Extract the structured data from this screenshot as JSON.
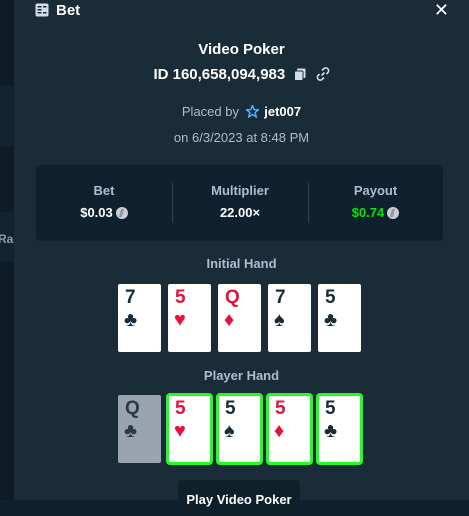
{
  "background": {
    "peek_text": "Rac"
  },
  "modal": {
    "title": "Bet",
    "close_symbol": "✕",
    "icons": {
      "header": "receipt-icon",
      "copy": "copy-icon",
      "link": "link-icon",
      "vip": "vip-star-icon",
      "coin": "litecoin-icon"
    }
  },
  "bet": {
    "game": "Video Poker",
    "id": "ID 160,658,094,983",
    "placed_by_label": "Placed by",
    "user": "jet007",
    "date": "on 6/3/2023 at 8:48 PM"
  },
  "stats": {
    "bet_label": "Bet",
    "bet_value": "$0.03",
    "multiplier_label": "Multiplier",
    "multiplier_value": "22.00×",
    "payout_label": "Payout",
    "payout_value": "$0.74"
  },
  "initial_hand": {
    "label": "Initial Hand",
    "cards": [
      {
        "rank": "7",
        "suit": "♣",
        "color": "black"
      },
      {
        "rank": "5",
        "suit": "♥",
        "color": "red"
      },
      {
        "rank": "Q",
        "suit": "♦",
        "color": "red"
      },
      {
        "rank": "7",
        "suit": "♠",
        "color": "black"
      },
      {
        "rank": "5",
        "suit": "♣",
        "color": "black"
      }
    ]
  },
  "player_hand": {
    "label": "Player Hand",
    "cards": [
      {
        "rank": "Q",
        "suit": "♣",
        "color": "black",
        "state": "discarded"
      },
      {
        "rank": "5",
        "suit": "♥",
        "color": "red",
        "state": "held"
      },
      {
        "rank": "5",
        "suit": "♠",
        "color": "black",
        "state": "held"
      },
      {
        "rank": "5",
        "suit": "♦",
        "color": "red",
        "state": "held"
      },
      {
        "rank": "5",
        "suit": "♣",
        "color": "black",
        "state": "held"
      }
    ]
  },
  "actions": {
    "play_label": "Play Video Poker"
  },
  "colors": {
    "modal_bg": "#1a2c38",
    "panel_bg": "#0f212e",
    "muted_text": "#b1bad3",
    "payout_green": "#00e701",
    "held_border": "#1fff20",
    "red_suit": "#e9113c"
  }
}
